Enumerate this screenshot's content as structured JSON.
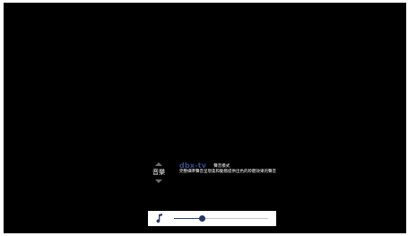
{
  "mode_selector": {
    "label": "音樂",
    "up_icon": "chevron-up-icon",
    "down_icon": "chevron-down-icon"
  },
  "mode_info": {
    "brand": "dbx-tv",
    "title": "聲音模式",
    "description": "完整細準聲音呈現柔和動態提供出色的聆聽效果的聲音"
  },
  "volume": {
    "icon": "music-note-icon",
    "level": 0.3
  },
  "colors": {
    "background": "#000000",
    "text": "#ffffff",
    "brand": "#3a4a8a",
    "slider_fill": "#2e3e78",
    "slider_track": "#c8c8c8",
    "panel": "#ffffff"
  }
}
